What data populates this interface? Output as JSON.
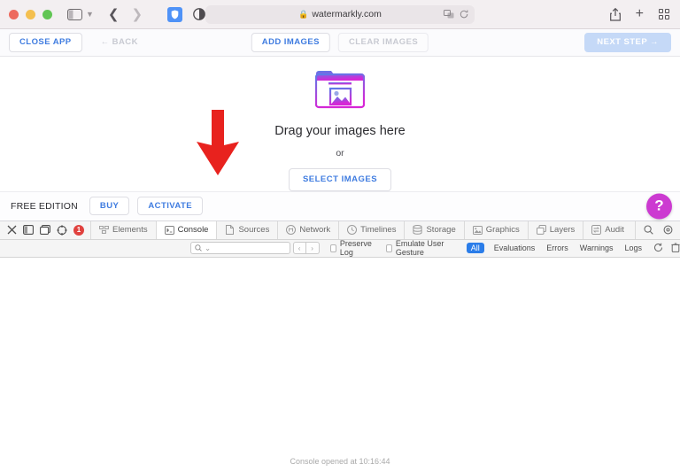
{
  "browser": {
    "window_controls": [
      "close",
      "minimize",
      "zoom"
    ],
    "sidebar_icon": "sidebar-icon",
    "back_icon": "chevron-left-icon",
    "forward_icon": "chevron-right-icon",
    "shield_icon": "shield-icon",
    "reader_icon": "contrast-icon",
    "url": "watermarkly.com",
    "lock_icon": "lock-icon",
    "translate_icon": "translate-icon",
    "reload_icon": "reload-icon",
    "share_icon": "share-icon",
    "new_tab_label": "+",
    "tab_overview_icon": "tab-grid-icon"
  },
  "app_toolbar": {
    "close_app": "CLOSE APP",
    "back": "BACK",
    "back_arrow": "←",
    "add_images": "ADD IMAGES",
    "clear_images": "CLEAR IMAGES",
    "next_step": "NEXT STEP",
    "next_arrow": "→"
  },
  "dropzone": {
    "folder_icon": "folder-image-icon",
    "title": "Drag your images here",
    "or": "or",
    "select_images": "SELECT IMAGES",
    "annotation_icon": "red-down-arrow",
    "annotation_color": "#e8221e",
    "gradient_start": "#5b7ce8",
    "gradient_end": "#d626d6"
  },
  "edition_bar": {
    "label": "FREE EDITION",
    "buy": "BUY",
    "activate": "ACTIVATE",
    "help": "?",
    "help_color": "#cc3ad1"
  },
  "inspector": {
    "close_icon": "close-icon",
    "dock_bottom_icon": "dock-bottom-icon",
    "dock_side_icon": "dock-side-icon",
    "inspect_icon": "crosshair-icon",
    "error_count": "1",
    "tabs": [
      {
        "label": "Elements",
        "icon": "elements-icon",
        "active": false
      },
      {
        "label": "Console",
        "icon": "console-icon",
        "active": true
      },
      {
        "label": "Sources",
        "icon": "document-icon",
        "active": false
      },
      {
        "label": "Network",
        "icon": "network-icon",
        "active": false
      },
      {
        "label": "Timelines",
        "icon": "clock-icon",
        "active": false
      },
      {
        "label": "Storage",
        "icon": "database-icon",
        "active": false
      },
      {
        "label": "Graphics",
        "icon": "graphics-icon",
        "active": false
      },
      {
        "label": "Layers",
        "icon": "layers-icon",
        "active": false
      },
      {
        "label": "Audit",
        "icon": "audit-icon",
        "active": false
      }
    ],
    "search_icon": "search-icon",
    "settings_icon": "gear-icon",
    "filter": {
      "search_placeholder": "",
      "search_icon": "search-icon",
      "prev": "‹",
      "next": "›",
      "preserve_log": "Preserve Log",
      "emulate_user_gesture": "Emulate User Gesture",
      "levels": [
        "All",
        "Evaluations",
        "Errors",
        "Warnings",
        "Logs"
      ],
      "active_level": "All",
      "active_color": "#2b7de9",
      "clear_icon": "clear-icon",
      "trash_icon": "trash-icon"
    },
    "console_status": "Console opened at 10:16:44"
  }
}
